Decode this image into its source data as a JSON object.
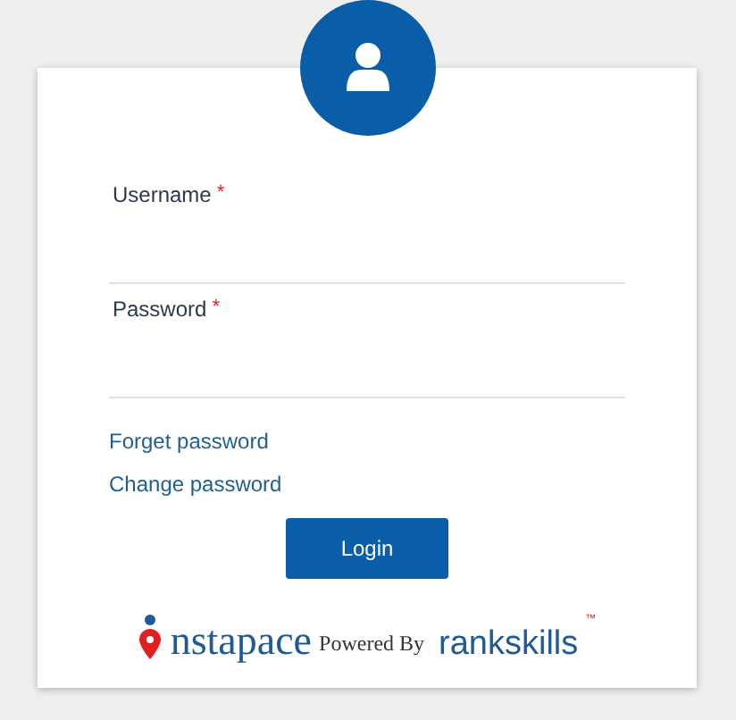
{
  "fields": [
    {
      "label": "Username",
      "required_mark": "*"
    },
    {
      "label": "Password",
      "required_mark": "*"
    }
  ],
  "links": [
    "Forget password",
    "Change password"
  ],
  "button": "Login",
  "footer": {
    "logo_text": "nstapace",
    "powered_by": "Powered By",
    "partner": "rankskills",
    "trademark": "™"
  }
}
